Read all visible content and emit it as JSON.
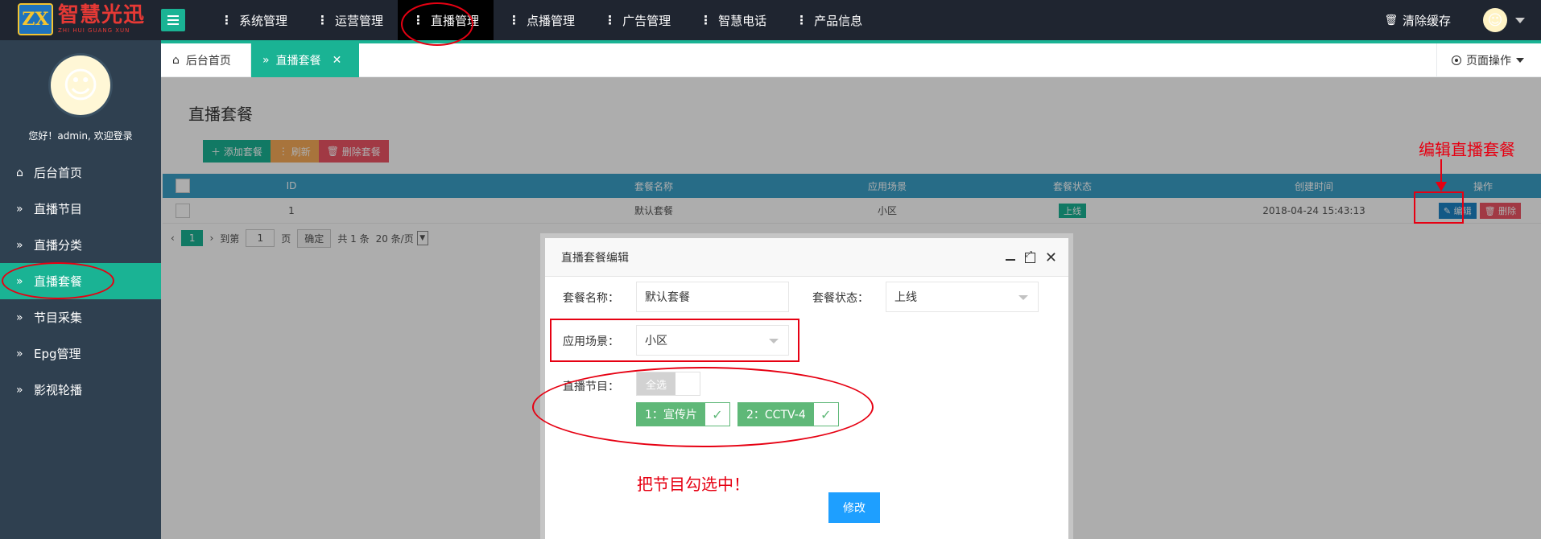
{
  "app": {
    "logo_cn": "智慧光迅",
    "logo_en": "ZHI HUI GUANG XUN",
    "logo_mark": "ZX"
  },
  "topnav": [
    {
      "label": "系统管理",
      "active": false
    },
    {
      "label": "运营管理",
      "active": false
    },
    {
      "label": "直播管理",
      "active": true
    },
    {
      "label": "点播管理",
      "active": false
    },
    {
      "label": "广告管理",
      "active": false
    },
    {
      "label": "智慧电话",
      "active": false
    },
    {
      "label": "产品信息",
      "active": false
    }
  ],
  "header": {
    "clear_cache": "清除缓存"
  },
  "sidebar": {
    "welcome": "您好！admin, 欢迎登录",
    "items": [
      {
        "label": "后台首页",
        "icon": "home-icon",
        "active": false
      },
      {
        "label": "直播节目",
        "icon": "double-chevron-icon",
        "active": false
      },
      {
        "label": "直播分类",
        "icon": "double-chevron-icon",
        "active": false
      },
      {
        "label": "直播套餐",
        "icon": "double-chevron-icon",
        "active": true
      },
      {
        "label": "节目采集",
        "icon": "double-chevron-icon",
        "active": false
      },
      {
        "label": "Epg管理",
        "icon": "double-chevron-icon",
        "active": false
      },
      {
        "label": "影视轮播",
        "icon": "double-chevron-icon",
        "active": false
      }
    ]
  },
  "tabs": {
    "home": "后台首页",
    "current": "直播套餐",
    "page_ops": "页面操作"
  },
  "content": {
    "title": "直播套餐",
    "toolbar": {
      "add": "添加套餐",
      "refresh": "刷新",
      "delete": "删除套餐"
    },
    "columns": [
      "ID",
      "套餐名称",
      "应用场景",
      "套餐状态",
      "创建时间",
      "操作"
    ],
    "rows": [
      {
        "id": "1",
        "name": "默认套餐",
        "scene": "小区",
        "status": "上线",
        "created": "2018-04-24 15:43:13",
        "edit": "编辑",
        "del": "删除"
      }
    ],
    "pager": {
      "current": "1",
      "goto": "到第",
      "page_input": "1",
      "page_unit": "页",
      "confirm": "确定",
      "total": "共 1 条",
      "page_size": "20 条/页"
    }
  },
  "modal": {
    "title": "直播套餐编辑",
    "name_label": "套餐名称：",
    "name_value": "默认套餐",
    "status_label": "套餐状态：",
    "status_value": "上线",
    "scene_label": "应用场景：",
    "scene_value": "小区",
    "programs_label": "直播节目：",
    "select_all": "全选",
    "programs": [
      {
        "label": "1：宣传片",
        "checked": true
      },
      {
        "label": "2：CCTV-4",
        "checked": true
      }
    ],
    "submit": "修改",
    "annotation": "把节目勾选中！"
  },
  "annotations": {
    "edit_package": "编辑直播套餐"
  },
  "colors": {
    "accent": "#1ab394",
    "dark_header": "#1f2530",
    "sidebar": "#2f4050",
    "annotation_red": "#e60012",
    "submit_blue": "#1e9fff",
    "program_green": "#5fb878"
  }
}
